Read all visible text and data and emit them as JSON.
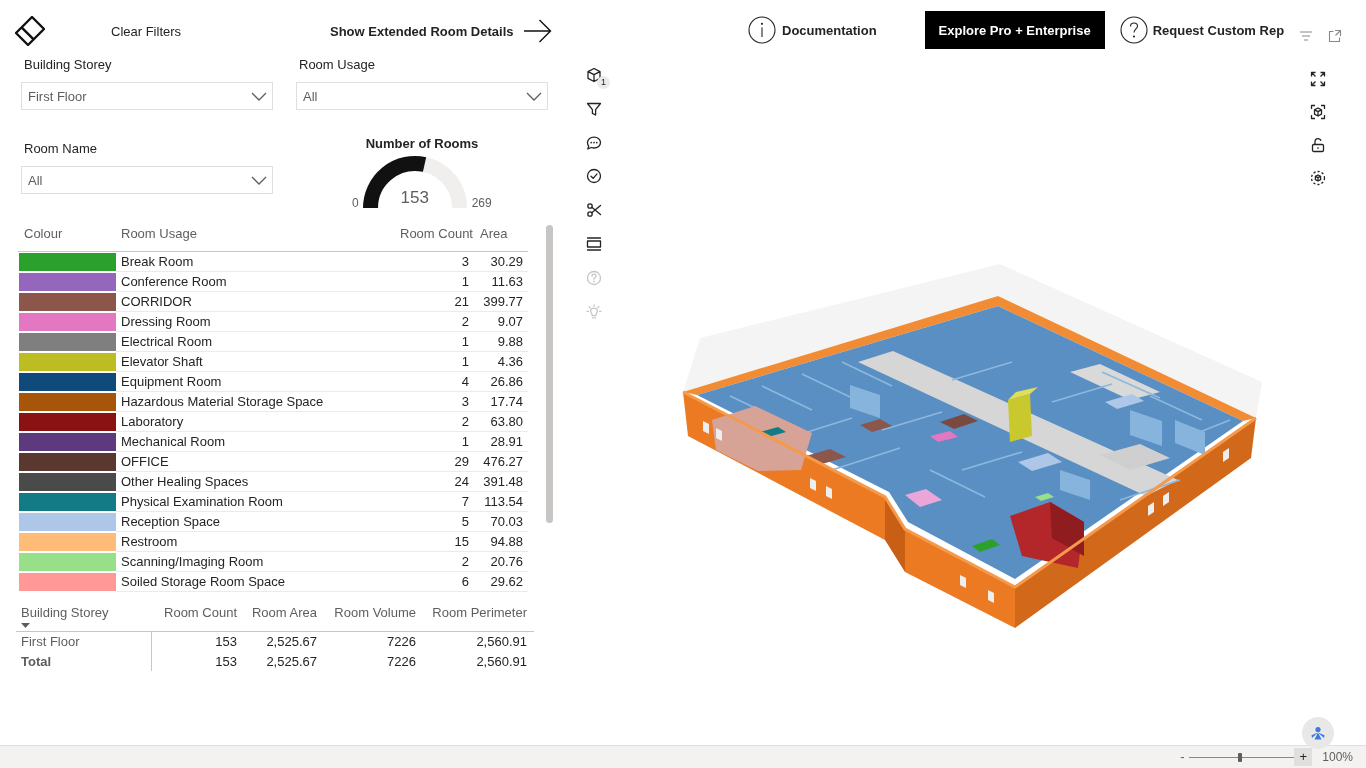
{
  "header": {
    "clear_filters": "Clear Filters",
    "extended_details": "Show Extended Room Details"
  },
  "nav": {
    "documentation": "Documentation",
    "explore": "Explore Pro + Enterprise",
    "request": "Request Custom Rep"
  },
  "filters": [
    {
      "label": "Building Storey",
      "value": "First Floor"
    },
    {
      "label": "Room Usage",
      "value": "All"
    },
    {
      "label": "Room Name",
      "value": "All"
    }
  ],
  "gauge": {
    "title": "Number of Rooms",
    "min": "0",
    "max": "269",
    "value": "153",
    "level": 0.569
  },
  "usage_table": {
    "columns": [
      "Colour",
      "Room Usage",
      "Room Count",
      "Area"
    ],
    "rows": [
      {
        "color": "#2ca02c",
        "usage": "Break Room",
        "count": "3",
        "area": "30.29"
      },
      {
        "color": "#9467bd",
        "usage": "Conference Room",
        "count": "1",
        "area": "11.63"
      },
      {
        "color": "#8c564b",
        "usage": "CORRIDOR",
        "count": "21",
        "area": "399.77"
      },
      {
        "color": "#e377c2",
        "usage": "Dressing Room",
        "count": "2",
        "area": "9.07"
      },
      {
        "color": "#7f7f7f",
        "usage": "Electrical Room",
        "count": "1",
        "area": "9.88"
      },
      {
        "color": "#bcbd22",
        "usage": "Elevator Shaft",
        "count": "1",
        "area": "4.36"
      },
      {
        "color": "#0f4a7a",
        "usage": "Equipment Room",
        "count": "4",
        "area": "26.86"
      },
      {
        "color": "#a6550b",
        "usage": "Hazardous Material Storage Space",
        "count": "3",
        "area": "17.74"
      },
      {
        "color": "#8b1212",
        "usage": "Laboratory",
        "count": "2",
        "area": "63.80"
      },
      {
        "color": "#5d3a7d",
        "usage": "Mechanical Room",
        "count": "1",
        "area": "28.91"
      },
      {
        "color": "#5a3830",
        "usage": "OFFICE",
        "count": "29",
        "area": "476.27"
      },
      {
        "color": "#4a4a4a",
        "usage": "Other Healing Spaces",
        "count": "24",
        "area": "391.48"
      },
      {
        "color": "#127b86",
        "usage": "Physical Examination Room",
        "count": "7",
        "area": "113.54"
      },
      {
        "color": "#aec7e8",
        "usage": "Reception Space",
        "count": "5",
        "area": "70.03"
      },
      {
        "color": "#ffbb78",
        "usage": "Restroom",
        "count": "15",
        "area": "94.88"
      },
      {
        "color": "#98df8a",
        "usage": "Scanning/Imaging Room",
        "count": "2",
        "area": "20.76"
      },
      {
        "color": "#ff9896",
        "usage": "Soiled Storage Room Space",
        "count": "6",
        "area": "29.62"
      }
    ]
  },
  "storey_table": {
    "columns": [
      {
        "label": "Building Storey",
        "sorted": true
      },
      {
        "label": "Room Count",
        "sorted": false
      },
      {
        "label": "Room Area",
        "sorted": false
      },
      {
        "label": "Room Volume",
        "sorted": false
      },
      {
        "label": "Room Perimeter",
        "sorted": false
      }
    ],
    "rows": [
      {
        "kind": "data",
        "cells": [
          "First Floor",
          "153",
          "2,525.67",
          "7226",
          "2,560.91"
        ]
      },
      {
        "kind": "total",
        "cells": [
          "Total",
          "153",
          "2,525.67",
          "7226",
          "2,560.91"
        ]
      }
    ]
  },
  "side_toolbar": [
    {
      "kind": "cube",
      "badge": "1",
      "disabled": false
    },
    {
      "kind": "filter",
      "disabled": false
    },
    {
      "kind": "comment",
      "disabled": false
    },
    {
      "kind": "check",
      "disabled": false
    },
    {
      "kind": "scissors",
      "disabled": false
    },
    {
      "kind": "frame",
      "disabled": false
    },
    {
      "kind": "help",
      "disabled": true
    },
    {
      "kind": "bulb",
      "disabled": true
    }
  ],
  "status_bar": {
    "zoom_out": "-",
    "zoom_slider": {
      "level": 0.48
    },
    "zoom_in": "+",
    "zoom": "100%"
  }
}
